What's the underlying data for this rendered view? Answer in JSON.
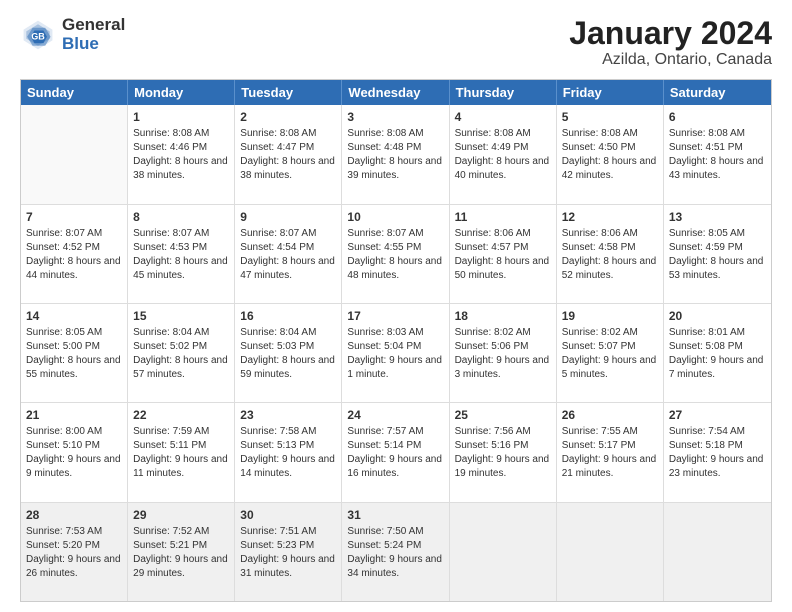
{
  "header": {
    "logo_general": "General",
    "logo_blue": "Blue",
    "title": "January 2024",
    "subtitle": "Azilda, Ontario, Canada"
  },
  "calendar": {
    "days_of_week": [
      "Sunday",
      "Monday",
      "Tuesday",
      "Wednesday",
      "Thursday",
      "Friday",
      "Saturday"
    ],
    "weeks": [
      [
        {
          "day": "",
          "sunrise": "",
          "sunset": "",
          "daylight": "",
          "empty": true
        },
        {
          "day": "1",
          "sunrise": "Sunrise: 8:08 AM",
          "sunset": "Sunset: 4:46 PM",
          "daylight": "Daylight: 8 hours and 38 minutes.",
          "empty": false
        },
        {
          "day": "2",
          "sunrise": "Sunrise: 8:08 AM",
          "sunset": "Sunset: 4:47 PM",
          "daylight": "Daylight: 8 hours and 38 minutes.",
          "empty": false
        },
        {
          "day": "3",
          "sunrise": "Sunrise: 8:08 AM",
          "sunset": "Sunset: 4:48 PM",
          "daylight": "Daylight: 8 hours and 39 minutes.",
          "empty": false
        },
        {
          "day": "4",
          "sunrise": "Sunrise: 8:08 AM",
          "sunset": "Sunset: 4:49 PM",
          "daylight": "Daylight: 8 hours and 40 minutes.",
          "empty": false
        },
        {
          "day": "5",
          "sunrise": "Sunrise: 8:08 AM",
          "sunset": "Sunset: 4:50 PM",
          "daylight": "Daylight: 8 hours and 42 minutes.",
          "empty": false
        },
        {
          "day": "6",
          "sunrise": "Sunrise: 8:08 AM",
          "sunset": "Sunset: 4:51 PM",
          "daylight": "Daylight: 8 hours and 43 minutes.",
          "empty": false
        }
      ],
      [
        {
          "day": "7",
          "sunrise": "Sunrise: 8:07 AM",
          "sunset": "Sunset: 4:52 PM",
          "daylight": "Daylight: 8 hours and 44 minutes.",
          "empty": false
        },
        {
          "day": "8",
          "sunrise": "Sunrise: 8:07 AM",
          "sunset": "Sunset: 4:53 PM",
          "daylight": "Daylight: 8 hours and 45 minutes.",
          "empty": false
        },
        {
          "day": "9",
          "sunrise": "Sunrise: 8:07 AM",
          "sunset": "Sunset: 4:54 PM",
          "daylight": "Daylight: 8 hours and 47 minutes.",
          "empty": false
        },
        {
          "day": "10",
          "sunrise": "Sunrise: 8:07 AM",
          "sunset": "Sunset: 4:55 PM",
          "daylight": "Daylight: 8 hours and 48 minutes.",
          "empty": false
        },
        {
          "day": "11",
          "sunrise": "Sunrise: 8:06 AM",
          "sunset": "Sunset: 4:57 PM",
          "daylight": "Daylight: 8 hours and 50 minutes.",
          "empty": false
        },
        {
          "day": "12",
          "sunrise": "Sunrise: 8:06 AM",
          "sunset": "Sunset: 4:58 PM",
          "daylight": "Daylight: 8 hours and 52 minutes.",
          "empty": false
        },
        {
          "day": "13",
          "sunrise": "Sunrise: 8:05 AM",
          "sunset": "Sunset: 4:59 PM",
          "daylight": "Daylight: 8 hours and 53 minutes.",
          "empty": false
        }
      ],
      [
        {
          "day": "14",
          "sunrise": "Sunrise: 8:05 AM",
          "sunset": "Sunset: 5:00 PM",
          "daylight": "Daylight: 8 hours and 55 minutes.",
          "empty": false
        },
        {
          "day": "15",
          "sunrise": "Sunrise: 8:04 AM",
          "sunset": "Sunset: 5:02 PM",
          "daylight": "Daylight: 8 hours and 57 minutes.",
          "empty": false
        },
        {
          "day": "16",
          "sunrise": "Sunrise: 8:04 AM",
          "sunset": "Sunset: 5:03 PM",
          "daylight": "Daylight: 8 hours and 59 minutes.",
          "empty": false
        },
        {
          "day": "17",
          "sunrise": "Sunrise: 8:03 AM",
          "sunset": "Sunset: 5:04 PM",
          "daylight": "Daylight: 9 hours and 1 minute.",
          "empty": false
        },
        {
          "day": "18",
          "sunrise": "Sunrise: 8:02 AM",
          "sunset": "Sunset: 5:06 PM",
          "daylight": "Daylight: 9 hours and 3 minutes.",
          "empty": false
        },
        {
          "day": "19",
          "sunrise": "Sunrise: 8:02 AM",
          "sunset": "Sunset: 5:07 PM",
          "daylight": "Daylight: 9 hours and 5 minutes.",
          "empty": false
        },
        {
          "day": "20",
          "sunrise": "Sunrise: 8:01 AM",
          "sunset": "Sunset: 5:08 PM",
          "daylight": "Daylight: 9 hours and 7 minutes.",
          "empty": false
        }
      ],
      [
        {
          "day": "21",
          "sunrise": "Sunrise: 8:00 AM",
          "sunset": "Sunset: 5:10 PM",
          "daylight": "Daylight: 9 hours and 9 minutes.",
          "empty": false
        },
        {
          "day": "22",
          "sunrise": "Sunrise: 7:59 AM",
          "sunset": "Sunset: 5:11 PM",
          "daylight": "Daylight: 9 hours and 11 minutes.",
          "empty": false
        },
        {
          "day": "23",
          "sunrise": "Sunrise: 7:58 AM",
          "sunset": "Sunset: 5:13 PM",
          "daylight": "Daylight: 9 hours and 14 minutes.",
          "empty": false
        },
        {
          "day": "24",
          "sunrise": "Sunrise: 7:57 AM",
          "sunset": "Sunset: 5:14 PM",
          "daylight": "Daylight: 9 hours and 16 minutes.",
          "empty": false
        },
        {
          "day": "25",
          "sunrise": "Sunrise: 7:56 AM",
          "sunset": "Sunset: 5:16 PM",
          "daylight": "Daylight: 9 hours and 19 minutes.",
          "empty": false
        },
        {
          "day": "26",
          "sunrise": "Sunrise: 7:55 AM",
          "sunset": "Sunset: 5:17 PM",
          "daylight": "Daylight: 9 hours and 21 minutes.",
          "empty": false
        },
        {
          "day": "27",
          "sunrise": "Sunrise: 7:54 AM",
          "sunset": "Sunset: 5:18 PM",
          "daylight": "Daylight: 9 hours and 23 minutes.",
          "empty": false
        }
      ],
      [
        {
          "day": "28",
          "sunrise": "Sunrise: 7:53 AM",
          "sunset": "Sunset: 5:20 PM",
          "daylight": "Daylight: 9 hours and 26 minutes.",
          "empty": false
        },
        {
          "day": "29",
          "sunrise": "Sunrise: 7:52 AM",
          "sunset": "Sunset: 5:21 PM",
          "daylight": "Daylight: 9 hours and 29 minutes.",
          "empty": false
        },
        {
          "day": "30",
          "sunrise": "Sunrise: 7:51 AM",
          "sunset": "Sunset: 5:23 PM",
          "daylight": "Daylight: 9 hours and 31 minutes.",
          "empty": false
        },
        {
          "day": "31",
          "sunrise": "Sunrise: 7:50 AM",
          "sunset": "Sunset: 5:24 PM",
          "daylight": "Daylight: 9 hours and 34 minutes.",
          "empty": false
        },
        {
          "day": "",
          "sunrise": "",
          "sunset": "",
          "daylight": "",
          "empty": true
        },
        {
          "day": "",
          "sunrise": "",
          "sunset": "",
          "daylight": "",
          "empty": true
        },
        {
          "day": "",
          "sunrise": "",
          "sunset": "",
          "daylight": "",
          "empty": true
        }
      ]
    ]
  }
}
